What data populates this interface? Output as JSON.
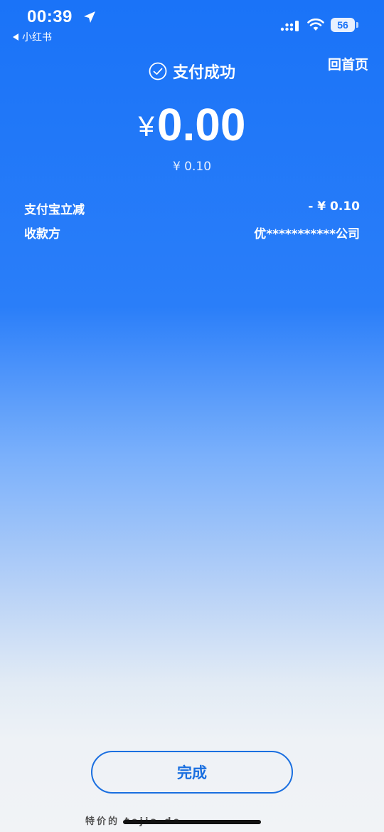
{
  "status_bar": {
    "time": "00:39",
    "back_app": "小红书",
    "battery": "56"
  },
  "header": {
    "title": "支付成功",
    "home_link": "回首页"
  },
  "payment": {
    "currency": "¥",
    "amount": "0.00",
    "original_amount": "¥ 0.10"
  },
  "details": [
    {
      "label": "支付宝立减",
      "value": "- ¥ 0.10"
    },
    {
      "label": "收款方",
      "value": "优***********公司"
    }
  ],
  "done_button": "完成",
  "watermark": "特价的 tejia.de",
  "colors": {
    "primary": "#1a73f8",
    "button": "#1a6fe0"
  }
}
